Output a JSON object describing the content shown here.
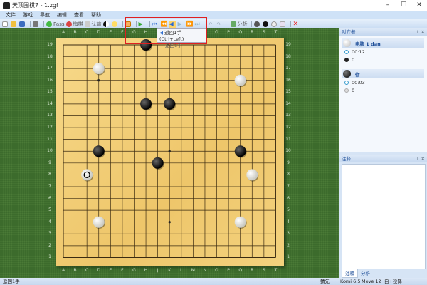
{
  "window": {
    "title": "天顶围棋7 - 1.zgf",
    "minimize": "–",
    "maximize": "☐",
    "close": "✕"
  },
  "menu": [
    "文件",
    "游戏",
    "导航",
    "编辑",
    "查看",
    "帮助"
  ],
  "toolbar": {
    "pass": "Pass",
    "undo": "悔棋",
    "resign": "认输",
    "analyze": "分析"
  },
  "tooltip": {
    "title": "返回1手 (Ctrl+Left)",
    "desc": "返回1手"
  },
  "board": {
    "columns": [
      "A",
      "B",
      "C",
      "D",
      "E",
      "F",
      "G",
      "H",
      "J",
      "K",
      "L",
      "M",
      "N",
      "O",
      "P",
      "Q",
      "R",
      "S",
      "T"
    ],
    "rows": [
      "19",
      "18",
      "17",
      "16",
      "15",
      "14",
      "13",
      "12",
      "11",
      "10",
      "9",
      "8",
      "7",
      "6",
      "5",
      "4",
      "3",
      "2",
      "1"
    ],
    "stones": [
      {
        "pos": "H19",
        "color": "black"
      },
      {
        "pos": "D17",
        "color": "white"
      },
      {
        "pos": "Q16",
        "color": "white"
      },
      {
        "pos": "H14",
        "color": "black"
      },
      {
        "pos": "K14",
        "color": "black"
      },
      {
        "pos": "D10",
        "color": "black"
      },
      {
        "pos": "Q10",
        "color": "black"
      },
      {
        "pos": "J9",
        "color": "black"
      },
      {
        "pos": "C8",
        "color": "white",
        "last_move": true
      },
      {
        "pos": "R8",
        "color": "white"
      },
      {
        "pos": "D4",
        "color": "white"
      },
      {
        "pos": "Q4",
        "color": "white"
      }
    ]
  },
  "players_panel": {
    "title": "对弈者",
    "players": [
      {
        "name": "电脑 1 dan",
        "color": "white",
        "time": "00:12",
        "captures": "0"
      },
      {
        "name": "你",
        "color": "black",
        "time": "00:03",
        "captures": "0"
      }
    ]
  },
  "comment_panel": {
    "title": "注释",
    "tabs": [
      "注释",
      "分析"
    ]
  },
  "status": {
    "message": "返回1手",
    "handicap": "猜先",
    "komi": "Komi 6.5",
    "move": "Move 12",
    "result": "白+投降"
  }
}
